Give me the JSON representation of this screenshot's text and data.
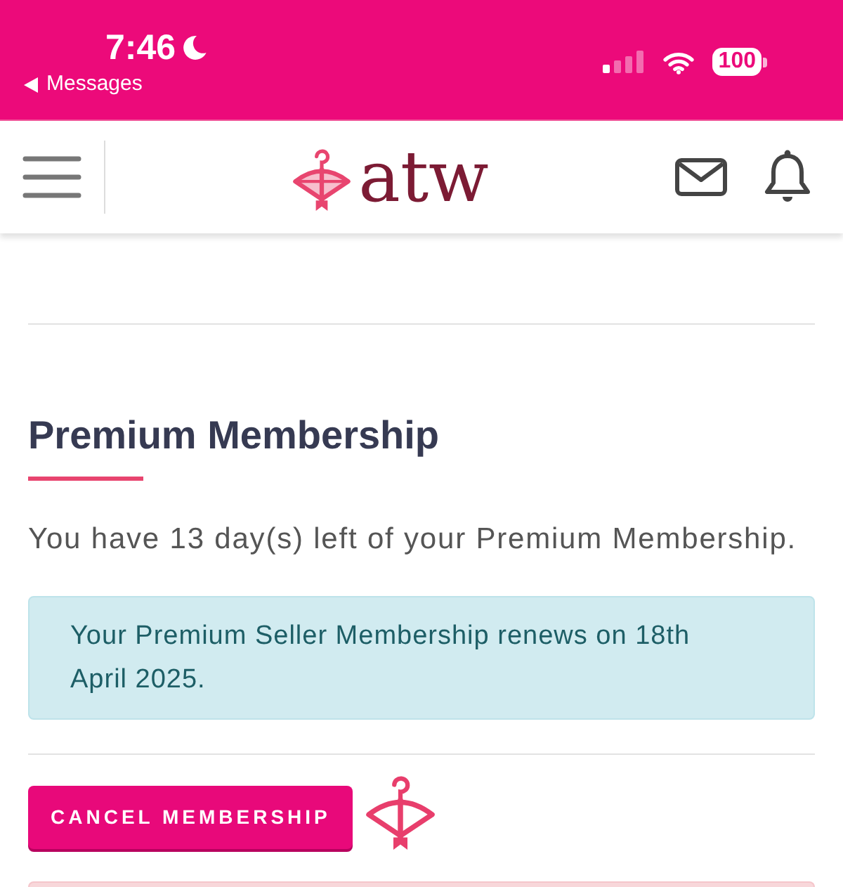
{
  "status_bar": {
    "time": "7:46",
    "do_not_disturb": true,
    "back_label": "Messages",
    "battery": "100"
  },
  "header": {
    "logo_text": "atw"
  },
  "membership": {
    "title": "Premium Membership",
    "summary": "You have 13 day(s) left of your Premium Membership.",
    "notice": "Your Premium Seller Membership renews on 18th April 2025.",
    "cancel_button": "CANCEL MEMBERSHIP",
    "loading_indicator": true
  },
  "bottom_alert": {
    "kind": "danger"
  }
}
